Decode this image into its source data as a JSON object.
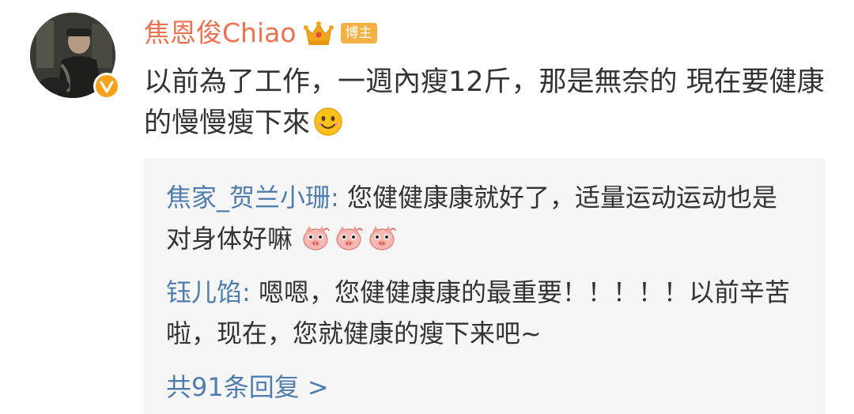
{
  "user": {
    "name": "焦恩俊Chiao",
    "badge": "博主"
  },
  "post": {
    "text": "以前為了工作，一週內瘦12斤，那是無奈的 現在要健康的慢慢瘦下來",
    "emoji": "smile-emoji"
  },
  "comments": [
    {
      "author": "焦家_贺兰小珊",
      "sep": ":",
      "text": " 您健健康康就好了，适量运动运动也是对身体好嘛 ",
      "emoji": [
        "pig-emoji",
        "pig-emoji",
        "pig-emoji"
      ]
    },
    {
      "author": "钰儿馅",
      "sep": ":",
      "text": " 嗯嗯，您健健康康的最重要！！！！！以前辛苦啦，现在，您就健康的瘦下来吧~"
    }
  ],
  "reply_link": "共91条回复 >",
  "colors": {
    "username": "#eb7350",
    "author": "#507daf",
    "badge": "#f5b043",
    "verified": "#f7a11a",
    "comment_bg": "#f6f6f6",
    "text": "#333333"
  }
}
